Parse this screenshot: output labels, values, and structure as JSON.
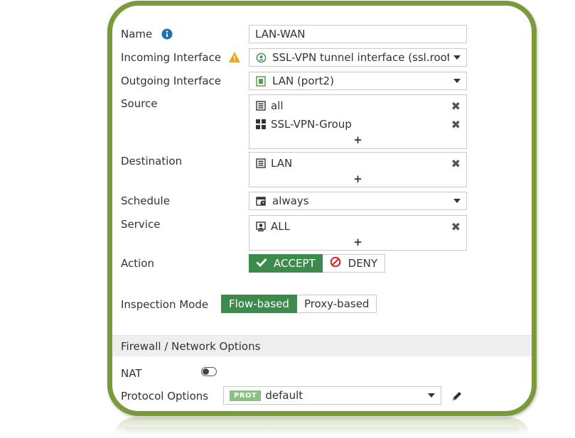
{
  "form": {
    "name": {
      "label": "Name",
      "value": "LAN-WAN"
    },
    "incoming": {
      "label": "Incoming Interface",
      "value": "SSL-VPN tunnel interface (ssl.root)"
    },
    "outgoing": {
      "label": "Outgoing Interface",
      "value": "LAN (port2)"
    },
    "source": {
      "label": "Source",
      "items": [
        "all",
        "SSL-VPN-Group"
      ],
      "add": "+"
    },
    "destination": {
      "label": "Destination",
      "items": [
        "LAN"
      ],
      "add": "+"
    },
    "schedule": {
      "label": "Schedule",
      "value": "always"
    },
    "service": {
      "label": "Service",
      "items": [
        "ALL"
      ],
      "add": "+"
    },
    "action": {
      "label": "Action",
      "accept": "ACCEPT",
      "deny": "DENY",
      "selected": "ACCEPT"
    },
    "inspection": {
      "label": "Inspection Mode",
      "flow": "Flow-based",
      "proxy": "Proxy-based",
      "selected": "Flow-based"
    }
  },
  "section": {
    "title": "Firewall / Network Options"
  },
  "nat": {
    "label": "NAT",
    "enabled": false
  },
  "protocol": {
    "label": "Protocol Options",
    "badge": "PROT",
    "value": "default"
  },
  "colors": {
    "frame": "#7a9a3c",
    "active": "#3d8b4c",
    "badge": "#8ac086",
    "warning": "#f0a30a",
    "info": "#1f6fb2",
    "deny": "#d22"
  }
}
